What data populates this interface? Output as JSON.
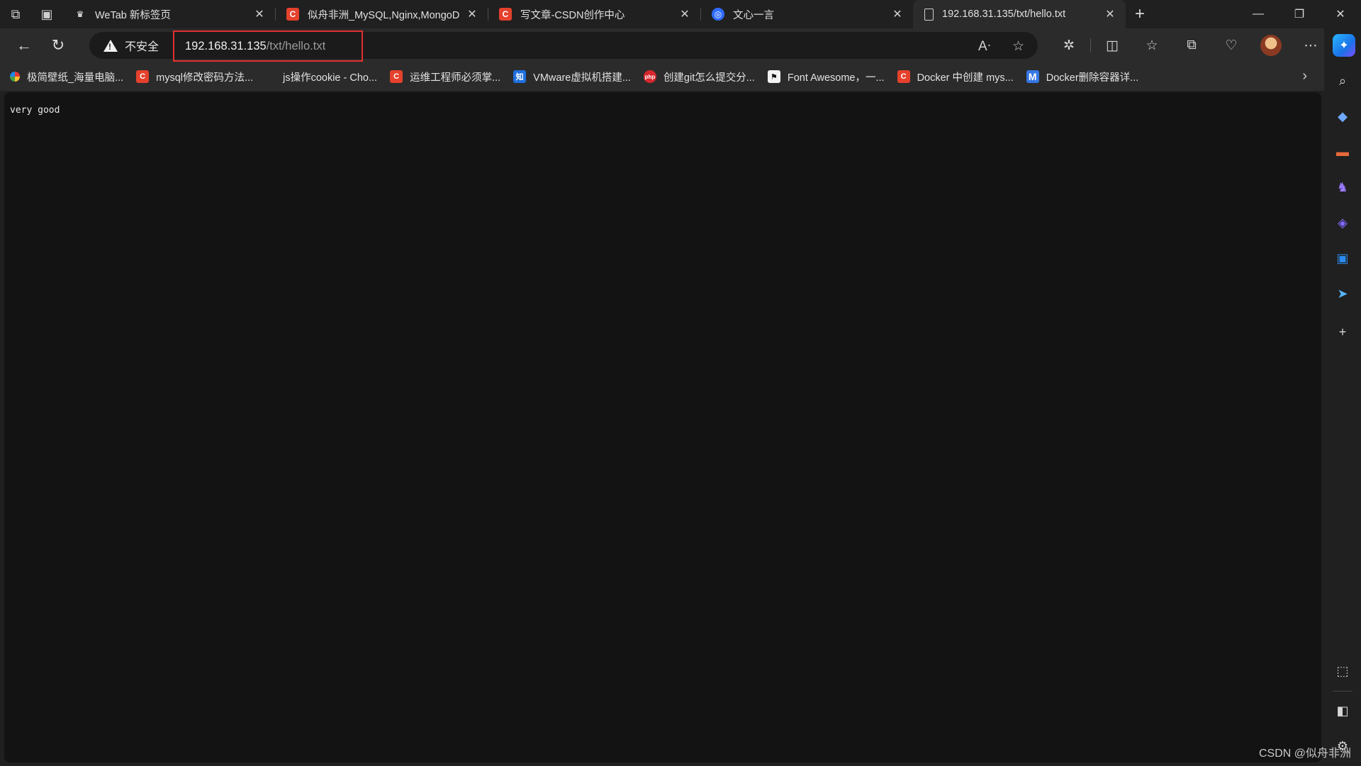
{
  "tabs": [
    {
      "title": "WeTab 新标签页",
      "favicon": "wetab-icon",
      "active": false
    },
    {
      "title": "似舟非洲_MySQL,Nginx,MongoD",
      "favicon": "csdn-icon",
      "active": false
    },
    {
      "title": "写文章-CSDN创作中心",
      "favicon": "csdn-icon",
      "active": false
    },
    {
      "title": "文心一言",
      "favicon": "wenxin-icon",
      "active": false
    },
    {
      "title": "192.168.31.135/txt/hello.txt",
      "favicon": "document-icon",
      "active": true
    }
  ],
  "tab_close_glyph": "✕",
  "new_tab_glyph": "+",
  "window_controls": {
    "minimize": "—",
    "restore": "❐",
    "close": "✕"
  },
  "toolbar": {
    "security_label": "不安全",
    "url_host": "192.168.31.135",
    "url_path": "/txt/hello.txt"
  },
  "bookmarks": [
    {
      "label": "极简壁纸_海量电脑...",
      "icon": "jijian-icon",
      "glyph": ""
    },
    {
      "label": "mysql修改密码方法...",
      "icon": "csdn-icon",
      "glyph": "C"
    },
    {
      "label": "js操作cookie - Cho...",
      "icon": "",
      "glyph": ""
    },
    {
      "label": "运维工程师必须掌...",
      "icon": "csdn-icon",
      "glyph": "C"
    },
    {
      "label": "VMware虚拟机搭建...",
      "icon": "zhihu-icon",
      "glyph": "知"
    },
    {
      "label": "创建git怎么提交分...",
      "icon": "php-icon",
      "glyph": "php"
    },
    {
      "label": "Font Awesome，一...",
      "icon": "flag-icon",
      "glyph": "⚑"
    },
    {
      "label": "Docker 中创建 mys...",
      "icon": "csdn-icon",
      "glyph": "C"
    },
    {
      "label": "Docker删除容器详...",
      "icon": "m-icon",
      "glyph": "M"
    }
  ],
  "page": {
    "text": "very good"
  },
  "watermark": "CSDN @似舟非洲",
  "colors": {
    "url_highlight": "#e03030",
    "csdn_red": "#e5412d",
    "page_bg": "#131313"
  }
}
